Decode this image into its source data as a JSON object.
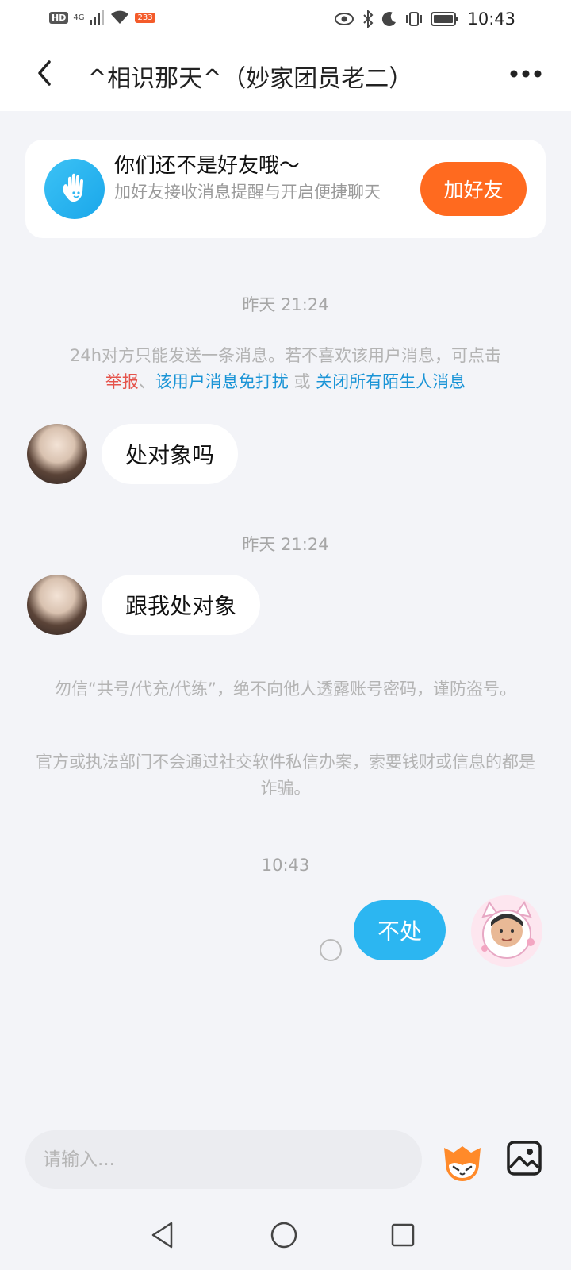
{
  "status_bar": {
    "hd": "HD",
    "network": "4G",
    "badge": "233",
    "time": "10:43"
  },
  "header": {
    "title": "^相识那天^（妙家团员老二）"
  },
  "friend_card": {
    "title": "你们还不是好友哦～",
    "desc": "加好友接收消息提醒与开启便捷聊天",
    "button": "加好友"
  },
  "conversation": {
    "ts1": "昨天 21:24",
    "notice_text": "24h对方只能发送一条消息。若不喜欢该用户消息，可点击",
    "link_report": "举报",
    "sep1": "、",
    "link_mute": "该用户消息免打扰",
    "or": " 或 ",
    "link_close_all": "关闭所有陌生人消息",
    "msg1": "处对象吗",
    "ts2": "昨天 21:24",
    "msg2": "跟我处对象",
    "warning1": "勿信“共号/代充/代练”，绝不向他人透露账号密码，谨防盗号。",
    "warning2": "官方或执法部门不会通过社交软件私信办案，索要钱财或信息的都是诈骗。",
    "ts3": "10:43",
    "my_msg": "不处"
  },
  "input_bar": {
    "placeholder": "请输入..."
  },
  "colors": {
    "accent_orange": "#ff6a1f",
    "bubble_blue": "#2cb6f1",
    "link_blue": "#1a94d6",
    "link_red": "#e5534b"
  },
  "icons": {
    "back": "back-arrow-icon",
    "more": "more-dots-icon",
    "hand": "hand-wave-icon",
    "emoji": "fox-emoji-icon",
    "image": "image-icon",
    "nav_back": "triangle-back-icon",
    "nav_home": "circle-home-icon",
    "nav_recent": "square-recent-icon"
  }
}
